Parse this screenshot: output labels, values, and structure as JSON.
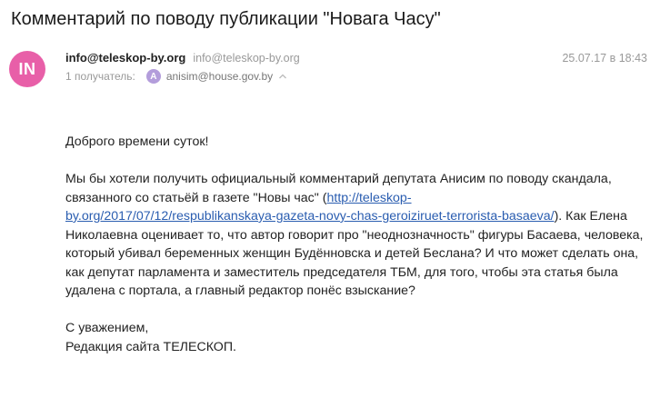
{
  "subject": "Комментарий по поводу публикации \"Новага Часу\"",
  "sender": {
    "avatar_initials": "IN",
    "name": "info@teleskop-by.org",
    "email": "info@teleskop-by.org"
  },
  "date": "25.07.17 в 18:43",
  "recipients": {
    "label": "1 получатель:",
    "avatar_letter": "A",
    "email": "anisim@house.gov.by"
  },
  "body": {
    "greeting": "Доброго времени суток!",
    "p1_before_link": "Мы бы хотели получить официальный комментарий депутата Анисим по поводу скандала, связанного со статьёй в газете \"Новы час\" (",
    "link": "http://teleskop-by.org/2017/07/12/respublikanskaya-gazeta-novy-chas-geroiziruet-terrorista-basaeva/",
    "link_line1": "http://teleskop-",
    "link_line2": "by.org/2017/07/12/respublikanskaya-gazeta-novy-chas-geroiziruet-terrorista-basaeva/",
    "p1_after_link": "). Как Елена Николаевна оценивает то, что автор говорит про \"неоднозначность\" фигуры Басаева, человека, который убивал беременных женщин Будённовска и детей Беслана? И что может сделать она, как депутат парламента и заместитель председателя ТБМ, для того, чтобы эта статья была удалена с портала, а главный редактор понёс взыскание?",
    "closing": "С уважением,",
    "signature": "Редакция сайта ТЕЛЕСКОП."
  },
  "colors": {
    "avatar_bg": "#e85fa8",
    "recipient_avatar_bg": "#b39ddb",
    "link": "#2a5db0",
    "muted": "#999999"
  }
}
